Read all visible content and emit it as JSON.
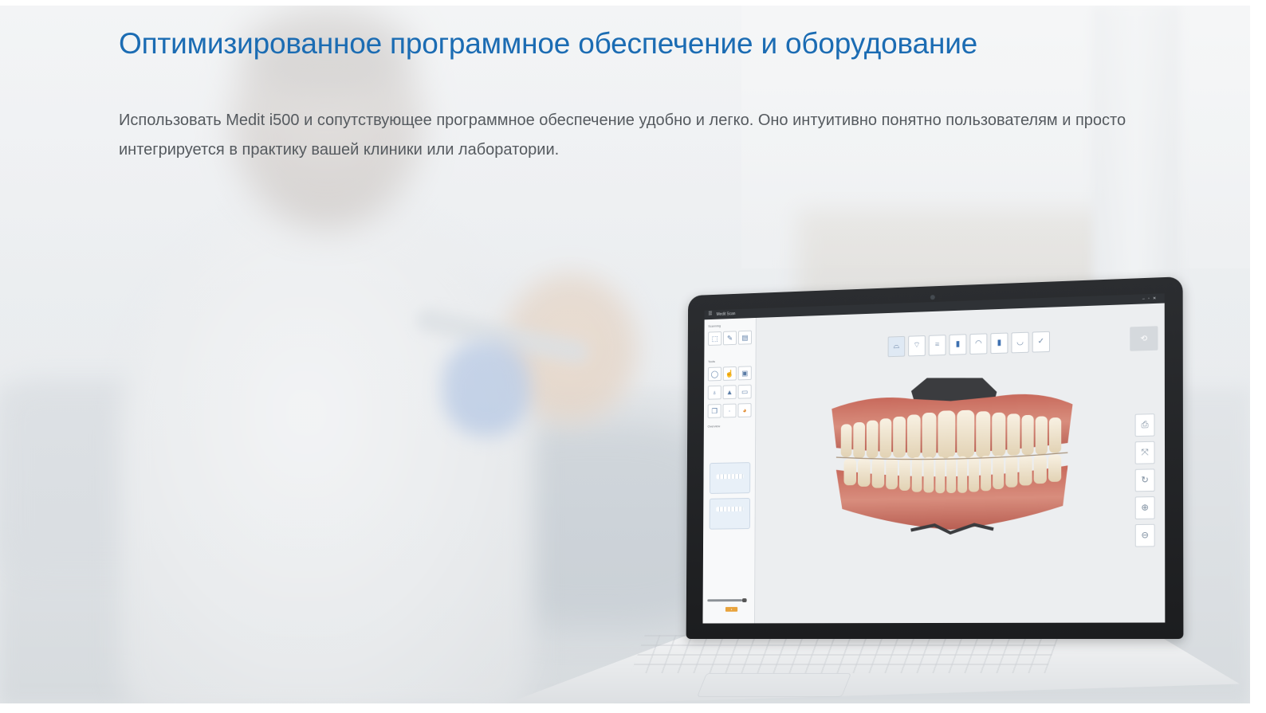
{
  "page": {
    "headline": "Оптимизированное программное обеспечение и оборудование",
    "description": "Использовать Medit i500 и сопутствующее программное обеспечение удобно и легко. Оно интуитивно понятно пользователям и просто интегрируется в практику вашей клиники или лаборатории."
  },
  "colors": {
    "headline": "#1b6cb3",
    "body_text": "#555a5f",
    "laptop_bezel": "#1c1d1f",
    "screen_bg": "#eceef0",
    "accent_button": "#e8a33c"
  },
  "app_screen": {
    "window_title": "Medit Scan",
    "menu_icon": "hamburger-menu-icon",
    "sections": {
      "scanning": "Scanning",
      "tools": "Tools",
      "overview": "Overview"
    },
    "scanning_tools": [
      "scan-select-icon",
      "scan-edit-icon",
      "scan-review-icon"
    ],
    "tool_icons": [
      "lasso-icon",
      "hand-select-icon",
      "layers-icon",
      "tooth-icon",
      "droplet-icon",
      "ruler-icon",
      "copy-icon",
      "dot-icon",
      "color-wheel-icon"
    ],
    "top_toolbar_icons": [
      "maxilla-scan-icon",
      "mandible-scan-icon",
      "occlusion-scan-icon",
      "abutment-icon",
      "upper-jaw-icon",
      "bite-icon",
      "lower-jaw-icon",
      "check-icon"
    ],
    "right_tool_icons": [
      "print-icon",
      "fit-view-icon",
      "rotate-icon",
      "zoom-in-icon",
      "zoom-out-icon"
    ],
    "compass_icon": "orientation-cube-icon",
    "model": "3d-dental-arch-scan"
  }
}
